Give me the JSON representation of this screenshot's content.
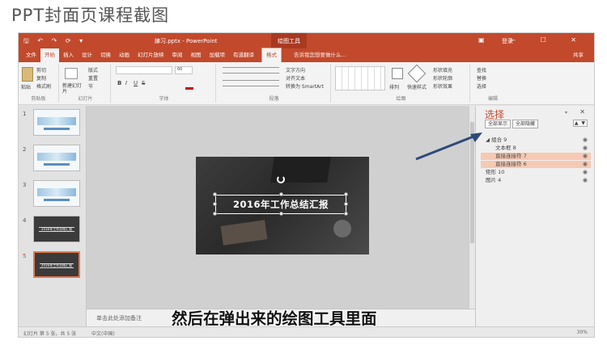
{
  "header": {
    "title": "PPT封面页课程截图"
  },
  "titlebar": {
    "quick_access": "🖫 ↶ ↷ ⟳ ▾",
    "title": "練习.pptx - PowerPoint",
    "context_tab": "绘图工具",
    "user": "登录",
    "window_controls": "▣ — ☐ ✕"
  },
  "tabs": [
    "文件",
    "开始",
    "插入",
    "设计",
    "切换",
    "动画",
    "幻灯片放映",
    "审阅",
    "视图",
    "加载项",
    "有道翻译"
  ],
  "active_tab": "开始",
  "format_tab": "格式",
  "tell_me": "告诉我您想要做什么...",
  "share": "共享",
  "ribbon": {
    "clipboard": {
      "paste": "粘贴",
      "cut": "剪切",
      "copy": "复制",
      "format_painter": "格式刷",
      "label": "剪贴板"
    },
    "slides": {
      "new_slide": "新建幻灯片",
      "layout": "版式",
      "reset": "重置",
      "section": "节",
      "label": "幻灯片"
    },
    "font": {
      "size": "60",
      "bold": "B",
      "italic": "I",
      "underline": "U",
      "strike": "S",
      "label": "字体"
    },
    "paragraph": {
      "text_direction": "文字方向",
      "align_text": "对齐文本",
      "smartart": "转换为 SmartArt",
      "label": "段落"
    },
    "drawing": {
      "arrange": "排列",
      "quick_styles": "快速样式",
      "shape_fill": "形状填充",
      "shape_outline": "形状轮廓",
      "shape_effects": "形状效果",
      "label": "绘图"
    },
    "editing": {
      "find": "查找",
      "replace": "替换",
      "select": "选择",
      "label": "编辑"
    }
  },
  "thumbnails": [
    {
      "num": "1"
    },
    {
      "num": "2"
    },
    {
      "num": "3"
    },
    {
      "num": "4",
      "text": "2016年工作总结汇报"
    },
    {
      "num": "5",
      "text": "2016年工作总结汇报"
    }
  ],
  "slide": {
    "title": "2016年工作总结汇报"
  },
  "notes": {
    "placeholder": "单击此处添加备注"
  },
  "selection_pane": {
    "title": "选择",
    "show_all": "全部显示",
    "hide_all": "全部隐藏",
    "move": "▲ ▼",
    "items": [
      {
        "label": "◢ 组合 9",
        "indent": 0,
        "highlight": false
      },
      {
        "label": "文本框 8",
        "indent": 1,
        "highlight": false
      },
      {
        "label": "直接连接符 7",
        "indent": 1,
        "highlight": true
      },
      {
        "label": "直接连接符 6",
        "indent": 1,
        "highlight": true
      },
      {
        "label": "矩形 10",
        "indent": 0,
        "highlight": false
      },
      {
        "label": "图片 4",
        "indent": 0,
        "highlight": false
      }
    ]
  },
  "status": {
    "slide_info": "幻灯片 第 5 张，共 5 张",
    "lang": "中文(中国)",
    "zoom": "30%"
  },
  "subtitle": "然后在弹出来的绘图工具里面",
  "colors": {
    "accent": "#c2492c",
    "arrow": "#2d4a78"
  }
}
